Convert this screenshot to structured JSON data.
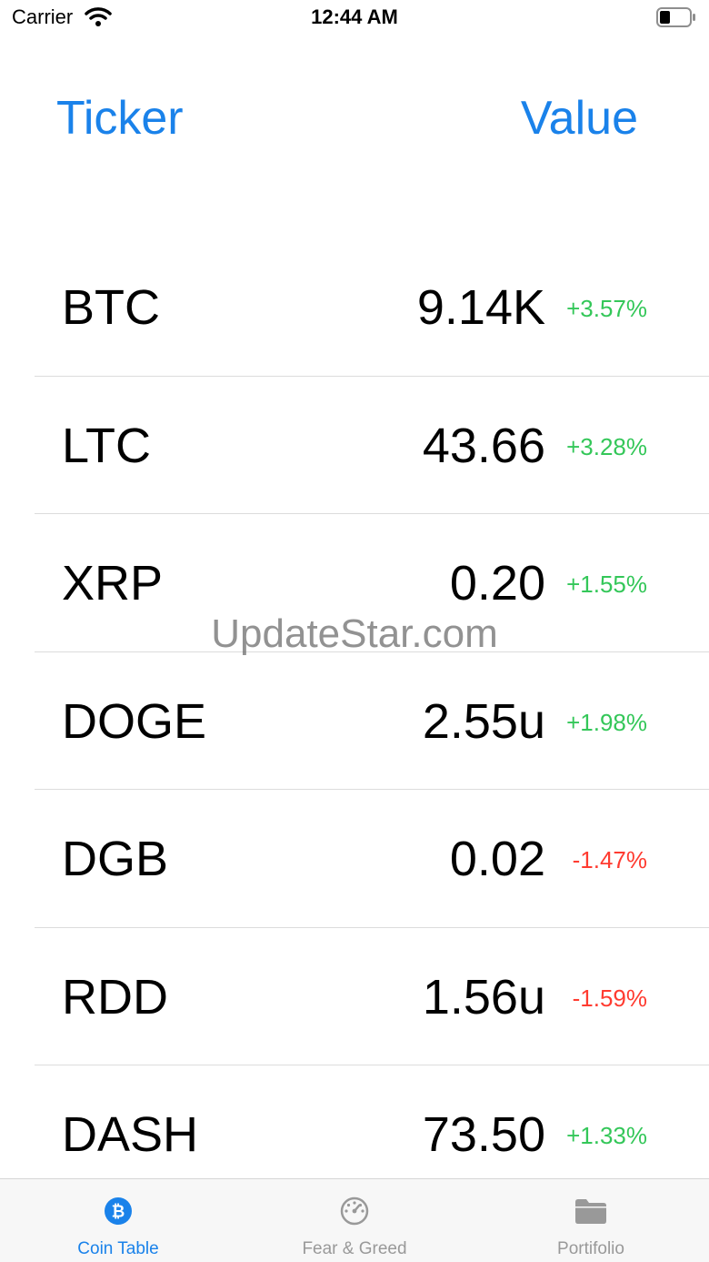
{
  "status_bar": {
    "carrier": "Carrier",
    "time": "12:44 AM"
  },
  "header": {
    "ticker_label": "Ticker",
    "value_label": "Value"
  },
  "coins": [
    {
      "ticker": "BTC",
      "value": "9.14K",
      "change": "+3.57%",
      "direction": "up"
    },
    {
      "ticker": "LTC",
      "value": "43.66",
      "change": "+3.28%",
      "direction": "up"
    },
    {
      "ticker": "XRP",
      "value": "0.20",
      "change": "+1.55%",
      "direction": "up"
    },
    {
      "ticker": "DOGE",
      "value": "2.55u",
      "change": "+1.98%",
      "direction": "up"
    },
    {
      "ticker": "DGB",
      "value": "0.02",
      "change": "-1.47%",
      "direction": "down"
    },
    {
      "ticker": "RDD",
      "value": "1.56u",
      "change": "-1.59%",
      "direction": "down"
    },
    {
      "ticker": "DASH",
      "value": "73.50",
      "change": "+1.33%",
      "direction": "up"
    }
  ],
  "watermark": "UpdateStar.com",
  "tabs": [
    {
      "label": "Coin Table",
      "icon": "bitcoin-icon",
      "active": true
    },
    {
      "label": "Fear & Greed",
      "icon": "speedometer-icon",
      "active": false
    },
    {
      "label": "Portifolio",
      "icon": "folder-icon",
      "active": false
    }
  ],
  "colors": {
    "accent": "#1a82ea",
    "positive": "#34c759",
    "negative": "#ff3b30",
    "inactive": "#999999"
  }
}
